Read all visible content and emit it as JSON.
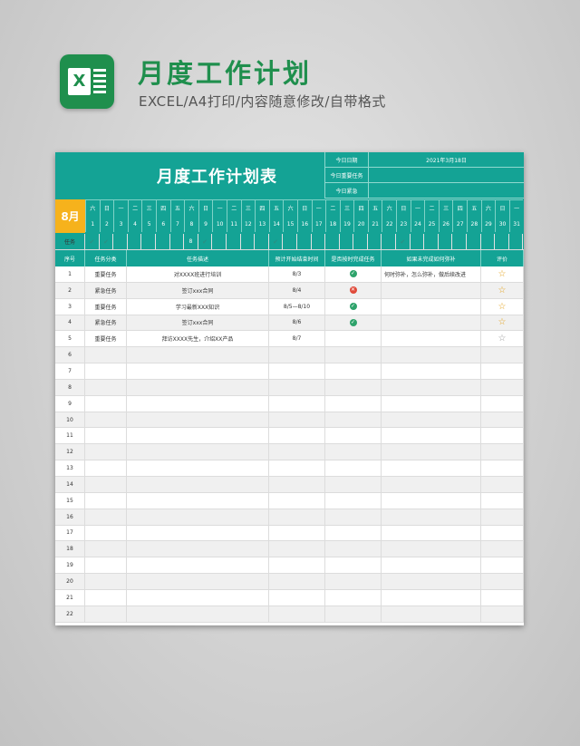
{
  "header": {
    "title": "月度工作计划",
    "subtitle": "EXCEL/A4打印/内容随意修改/自带格式",
    "logo_letter": "X"
  },
  "sheet": {
    "title": "月度工作计划表",
    "info": [
      {
        "label": "今日日期",
        "value": "2021年3月18日"
      },
      {
        "label": "今日重要任务",
        "value": ""
      },
      {
        "label": "今日紧急",
        "value": ""
      }
    ],
    "month": "8月",
    "weekdays": [
      "六",
      "日",
      "一",
      "二",
      "三",
      "四",
      "五",
      "六",
      "日",
      "一",
      "二",
      "三",
      "四",
      "五",
      "六",
      "日",
      "一",
      "二",
      "三",
      "四",
      "五",
      "六",
      "日",
      "一",
      "二",
      "三",
      "四",
      "五",
      "六",
      "日",
      "一"
    ],
    "days": [
      "1",
      "2",
      "3",
      "4",
      "5",
      "6",
      "7",
      "8",
      "9",
      "10",
      "11",
      "12",
      "13",
      "14",
      "15",
      "16",
      "17",
      "18",
      "19",
      "20",
      "21",
      "22",
      "23",
      "24",
      "25",
      "26",
      "27",
      "28",
      "29",
      "30",
      "31"
    ],
    "task_label": "任务",
    "task_marks": [
      "✔",
      "✔",
      "",
      "",
      "",
      "",
      "",
      "8",
      "✔",
      "",
      "",
      "",
      "",
      "✔",
      "",
      "",
      "",
      "",
      "",
      "",
      "",
      "",
      "✔",
      "",
      "",
      "",
      "",
      "",
      "",
      "",
      ""
    ],
    "columns": [
      "序号",
      "任务分类",
      "任务描述",
      "预计开始结束时间",
      "是否按时完成任务",
      "如果未完成如何弥补",
      "评价"
    ],
    "rows": [
      {
        "no": "1",
        "type": "重要任务",
        "desc": "对XXXX班进行培训",
        "time": "8/3",
        "done": "yes",
        "fix": "何时弥补，怎么弥补，做后续改进",
        "star": "full"
      },
      {
        "no": "2",
        "type": "紧急任务",
        "desc": "签订xxx合同",
        "time": "8/4",
        "done": "no",
        "fix": "",
        "star": "full"
      },
      {
        "no": "3",
        "type": "重要任务",
        "desc": "学习最新XXX知识",
        "time": "8/5—8/10",
        "done": "yes",
        "fix": "",
        "star": "full"
      },
      {
        "no": "4",
        "type": "紧急任务",
        "desc": "签订xxx合同",
        "time": "8/6",
        "done": "yes",
        "fix": "",
        "star": "full"
      },
      {
        "no": "5",
        "type": "重要任务",
        "desc": "拜访XXXX先生，介绍XX产品",
        "time": "8/7",
        "done": "",
        "fix": "",
        "star": "empty"
      },
      {
        "no": "6"
      },
      {
        "no": "7"
      },
      {
        "no": "8"
      },
      {
        "no": "9"
      },
      {
        "no": "10"
      },
      {
        "no": "11"
      },
      {
        "no": "12"
      },
      {
        "no": "13"
      },
      {
        "no": "14"
      },
      {
        "no": "15"
      },
      {
        "no": "16"
      },
      {
        "no": "17"
      },
      {
        "no": "18"
      },
      {
        "no": "19"
      },
      {
        "no": "20"
      },
      {
        "no": "21"
      },
      {
        "no": "22"
      }
    ]
  },
  "colors": {
    "teal": "#14a395",
    "month": "#f6b21c",
    "brand": "#1f8f4d"
  },
  "icons": {
    "done": "check-icon",
    "not_done": "cross-icon",
    "rating": "star-icon"
  }
}
